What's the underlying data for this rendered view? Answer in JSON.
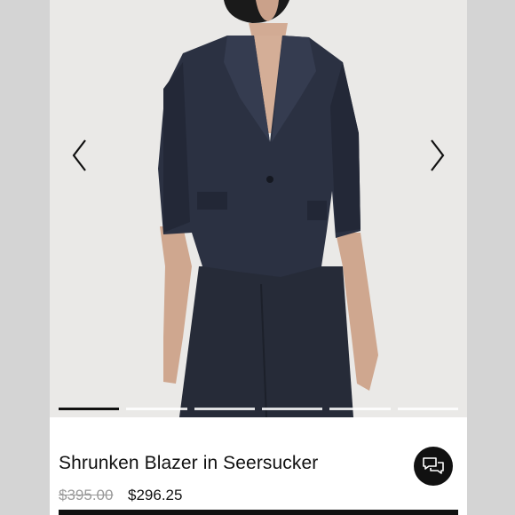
{
  "product": {
    "title": "Shrunken Blazer in Seersucker",
    "original_price": "$395.00",
    "sale_price": "$296.25"
  },
  "carousel": {
    "slides": 6,
    "active_index": 0
  },
  "icons": {
    "prev": "chevron-left-icon",
    "next": "chevron-right-icon",
    "chat": "chat-bubbles-icon"
  },
  "colors": {
    "background": "#e9e8e6",
    "accent": "#111111",
    "strike_price": "#9a9a9a"
  }
}
